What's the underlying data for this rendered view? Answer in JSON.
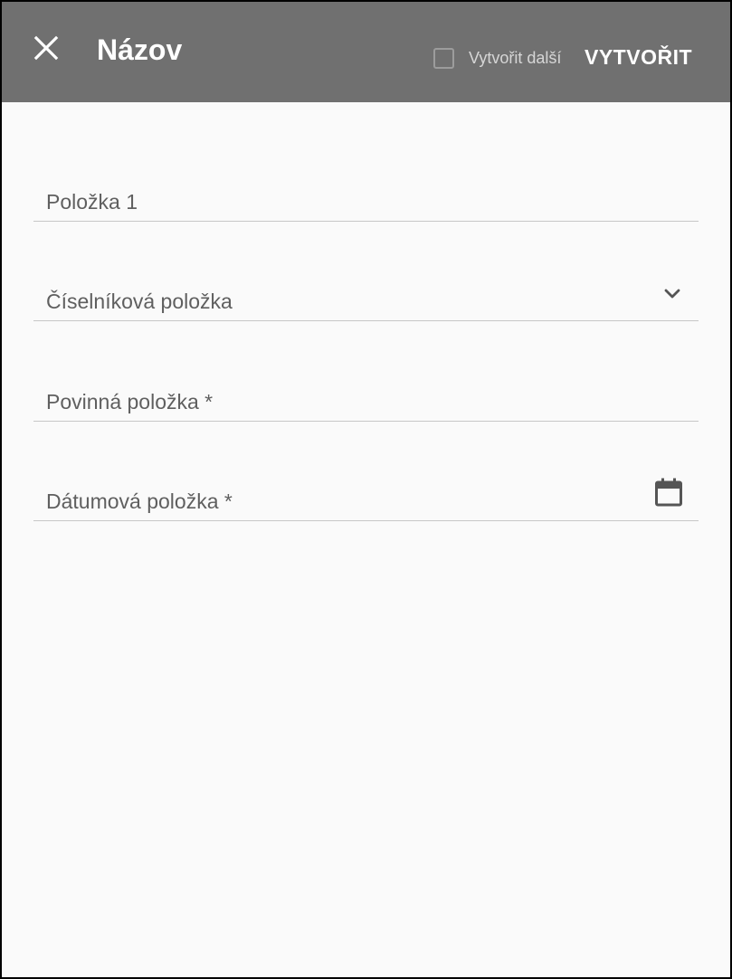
{
  "header": {
    "title": "Názov",
    "close_icon": "close-icon",
    "create_another_label": "Vytvořit další",
    "create_another_checked": false,
    "create_label": "VYTVOŘIT"
  },
  "form": {
    "fields": [
      {
        "label": "Položka 1",
        "type": "text"
      },
      {
        "label": "Číselníková položka",
        "type": "select",
        "icon": "chevron-down-icon"
      },
      {
        "label": "Povinná položka *",
        "type": "text"
      },
      {
        "label": "Dátumová položka *",
        "type": "date",
        "icon": "calendar-icon"
      }
    ]
  },
  "colors": {
    "appbar": "#707070",
    "background": "#fafafa",
    "field_text": "#5f5f5f",
    "divider": "#c7c7c7"
  }
}
